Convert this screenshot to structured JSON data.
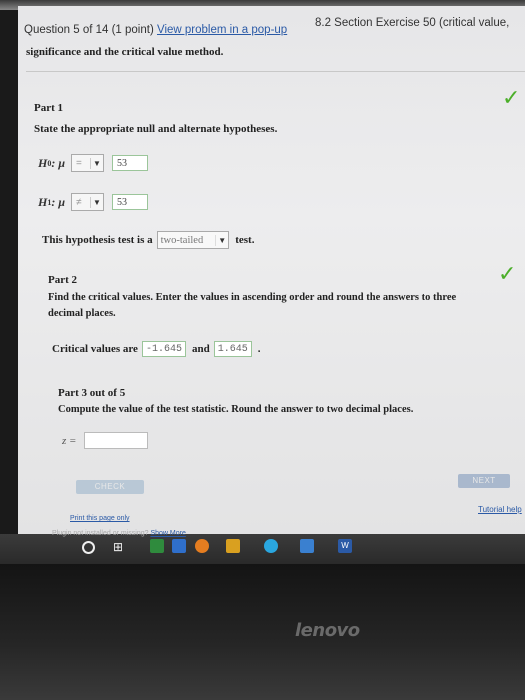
{
  "header": {
    "question_label": "Question 5 of 14 (1 point)",
    "popup_link": "View problem in a pop-up",
    "section_title": "8.2 Section Exercise 50 (critical value,"
  },
  "intro_text": "significance and the critical value method.",
  "part1": {
    "title": "Part 1",
    "instruction": "State the appropriate null and alternate hypotheses.",
    "h0": {
      "symbol": "H",
      "sub": "0",
      "param": ": μ",
      "operator": "=",
      "value": "53"
    },
    "h1": {
      "symbol": "H",
      "sub": "1",
      "param": ": μ",
      "operator": "≠",
      "value": "53"
    },
    "test_prefix": "This hypothesis test is a",
    "test_value": "two-tailed",
    "test_suffix": "test."
  },
  "part2": {
    "title": "Part 2",
    "instruction_line1": "Find the critical values. Enter the values in ascending order and round the answers to three",
    "instruction_line2": "decimal places.",
    "cv_prefix": "Critical values are",
    "cv1": "-1.645",
    "and_label": "and",
    "cv2": "1.645"
  },
  "part3": {
    "title": "Part 3 out of 5",
    "instruction": "Compute the value of the test statistic. Round the answer to two decimal places.",
    "z_label": "z ="
  },
  "buttons": {
    "check": "CHECK",
    "next": "NEXT"
  },
  "links": {
    "tutorial": "Tutorial help",
    "print": "Print this page only",
    "plugin_prefix": "Plugin not installed or missing?",
    "show_more": "Show More"
  },
  "taskbar": {
    "logo": "lenovo"
  },
  "colors": {
    "check_green": "#4caf2a",
    "link_blue": "#2b5aa6",
    "check_button": "#b9c8d6",
    "next_button": "#a9b8cd"
  }
}
